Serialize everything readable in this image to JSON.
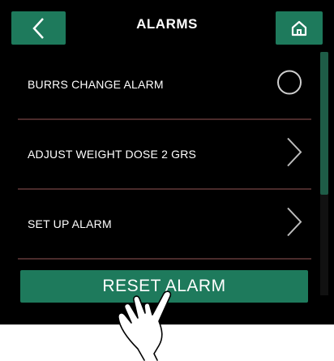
{
  "header": {
    "title": "ALARMS",
    "back_icon": "chevron-left-icon",
    "home_icon": "home-icon"
  },
  "list": {
    "items": [
      {
        "label": "BURRS CHANGE ALARM",
        "control": "toggle-circle",
        "state": "off"
      },
      {
        "label": "ADJUST WEIGHT DOSE 2 GRS",
        "control": "chevron-right"
      },
      {
        "label": "SET UP ALARM",
        "control": "chevron-right"
      }
    ]
  },
  "actions": {
    "reset_label": "RESET ALARM"
  },
  "overlay": {
    "icon": "tap-hand-icon"
  },
  "colors": {
    "background": "#000000",
    "accent": "#1e7a5c",
    "divider": "#4a2b2b",
    "text": "#ffffff"
  }
}
